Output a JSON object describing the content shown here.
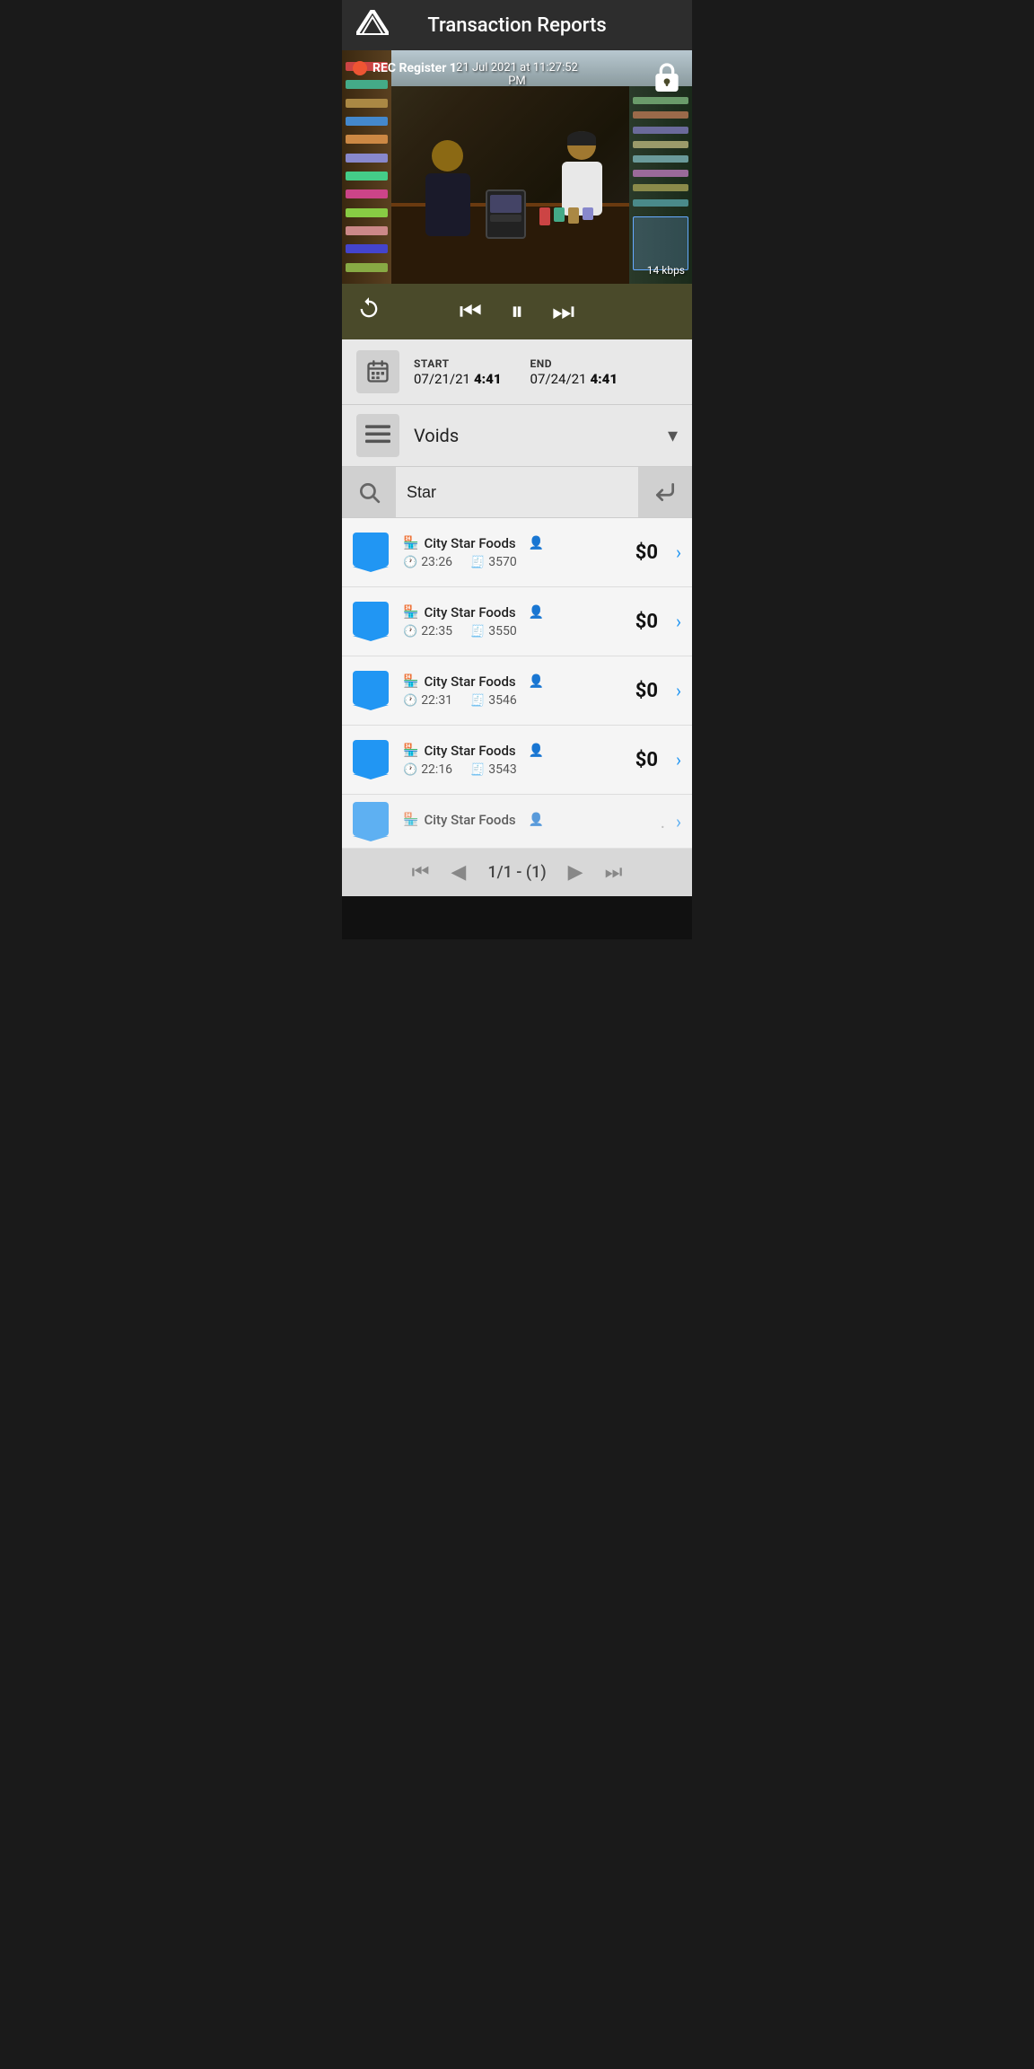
{
  "header": {
    "title": "Transaction Reports",
    "logo": "V"
  },
  "video": {
    "rec_label": "REC  Register 1",
    "timestamp": "21 Jul 2021 at 11:27:52",
    "timestamp_line2": "PM",
    "bitrate": "14 kbps"
  },
  "date_range": {
    "start_label": "START",
    "start_date": "07/21/21",
    "start_time": "4:41",
    "end_label": "END",
    "end_date": "07/24/21",
    "end_time": "4:41"
  },
  "filter": {
    "type_label": "Voids"
  },
  "search": {
    "value": "Star",
    "placeholder": "Search..."
  },
  "transactions": [
    {
      "store": "City Star Foods",
      "time": "23:26",
      "receipt": "3570",
      "amount": "$0"
    },
    {
      "store": "City Star Foods",
      "time": "22:35",
      "receipt": "3550",
      "amount": "$0"
    },
    {
      "store": "City Star Foods",
      "time": "22:31",
      "receipt": "3546",
      "amount": "$0"
    },
    {
      "store": "City Star Foods",
      "time": "22:16",
      "receipt": "3543",
      "amount": "$0"
    },
    {
      "store": "City Star Foods",
      "time": "",
      "receipt": "",
      "amount": "",
      "partial": true
    }
  ],
  "pagination": {
    "current": "1/1 - (1)"
  },
  "icons": {
    "calendar": "📅",
    "list": "≡",
    "search": "🔍",
    "store": "🏪",
    "person": "👤",
    "clock": "🕐",
    "receipt": "🧾"
  }
}
